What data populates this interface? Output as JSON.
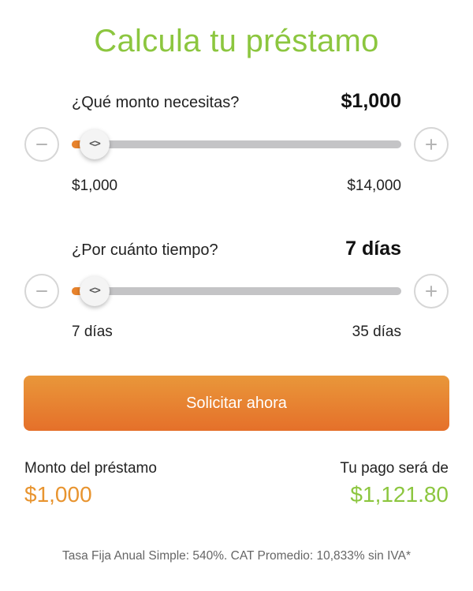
{
  "title": "Calcula tu préstamo",
  "amount": {
    "question": "¿Qué monto necesitas?",
    "value": "$1,000",
    "min_label": "$1,000",
    "max_label": "$14,000",
    "fraction": 0
  },
  "term": {
    "question": "¿Por cuánto tiempo?",
    "value": "7 días",
    "min_label": "7 días",
    "max_label": "35 días",
    "fraction": 0
  },
  "cta_label": "Solicitar ahora",
  "summary": {
    "loan_label": "Monto del préstamo",
    "loan_value": "$1,000",
    "payment_label": "Tu pago será de",
    "payment_value": "$1,121.80"
  },
  "footnote": "Tasa Fija Anual Simple: 540%. CAT Promedio: 10,833% sin IVA*",
  "icons": {
    "decrease": "minus-icon",
    "increase": "plus-icon",
    "thumb": "chevron-left-right-icon"
  },
  "colors": {
    "title": "#8cc63f",
    "accent_orange": "#e8832c",
    "payment_green": "#8cc63f",
    "track": "#c4c4c6"
  }
}
